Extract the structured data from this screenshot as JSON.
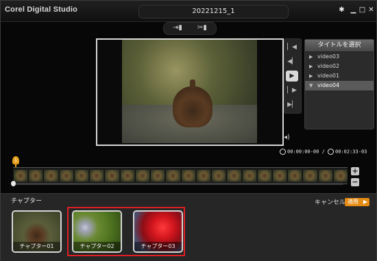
{
  "app": {
    "title": "Corel Digital Studio",
    "project_name": "20221215_1"
  },
  "window_controls": [
    "settings-icon",
    "minimize-icon",
    "maximize-icon",
    "close-icon"
  ],
  "toolbar": {
    "tools": [
      "trim-in-icon",
      "trim-out-icon"
    ]
  },
  "player": {
    "side_controls": [
      "go-to-start-icon",
      "previous-frame-icon",
      "play-icon",
      "next-frame-icon",
      "go-to-end-icon"
    ]
  },
  "title_panel": {
    "header": "タイトルを選択",
    "items": [
      {
        "label": "video03",
        "selected": false
      },
      {
        "label": "video02",
        "selected": false
      },
      {
        "label": "video01",
        "selected": false
      },
      {
        "label": "video04",
        "selected": true
      }
    ]
  },
  "timecode": {
    "current": "00:00:00-00",
    "separator": "/",
    "total": "00:02:33-03"
  },
  "timeline": {
    "marker_number": "1",
    "zoom_in": "+",
    "zoom_out": "−"
  },
  "chapters": {
    "label": "チャプター",
    "cancel_label": "キャンセル",
    "apply_label": "適用",
    "items": [
      {
        "label": "チャプター01"
      },
      {
        "label": "チャプター02"
      },
      {
        "label": "チャプター03"
      }
    ]
  },
  "colors": {
    "accent": "#e58a12",
    "highlight": "#df1f24"
  }
}
